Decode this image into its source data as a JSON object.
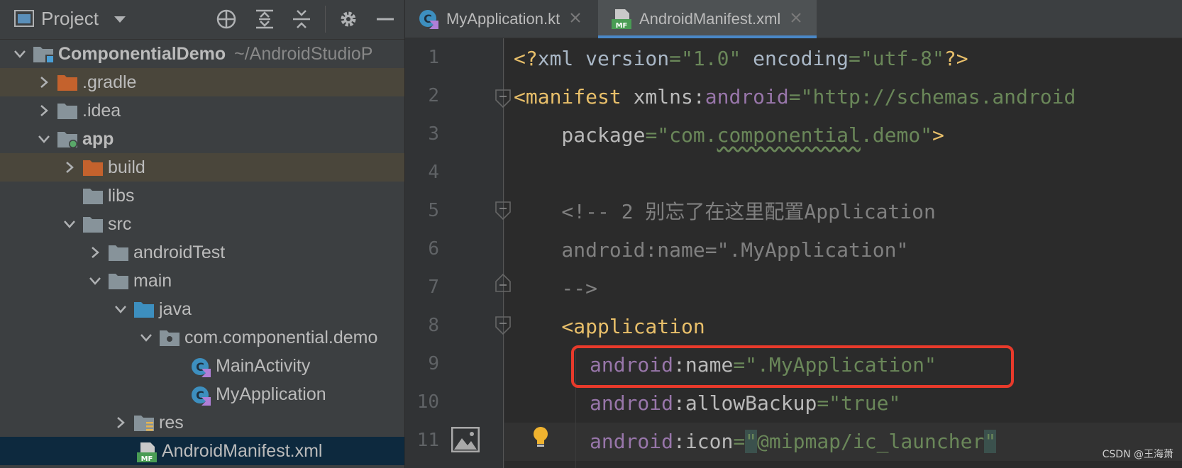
{
  "sidebar": {
    "title": "Project",
    "icons": [
      "project-window-icon",
      "chevron-down-icon",
      "locate-icon",
      "expand-all-icon",
      "collapse-all-icon",
      "gear-icon",
      "minimize-icon"
    ],
    "tree": [
      {
        "label": "ComponentialDemo",
        "path": "~/AndroidStudioP",
        "type": "module-folder",
        "expanded": true
      },
      {
        "label": ".gradle",
        "type": "folder-orange",
        "expanded": false
      },
      {
        "label": ".idea",
        "type": "folder",
        "expanded": false
      },
      {
        "label": "app",
        "type": "module-folder",
        "expanded": true
      },
      {
        "label": "build",
        "type": "folder-orange",
        "expanded": false
      },
      {
        "label": "libs",
        "type": "folder"
      },
      {
        "label": "src",
        "type": "folder",
        "expanded": true
      },
      {
        "label": "androidTest",
        "type": "folder",
        "expanded": false
      },
      {
        "label": "main",
        "type": "folder",
        "expanded": true
      },
      {
        "label": "java",
        "type": "folder-blue",
        "expanded": true
      },
      {
        "label": "com.componential.demo",
        "type": "package",
        "expanded": true
      },
      {
        "label": "MainActivity",
        "type": "kotlin-class"
      },
      {
        "label": "MyApplication",
        "type": "kotlin-class"
      },
      {
        "label": "res",
        "type": "res-folder",
        "expanded": false
      },
      {
        "label": "AndroidManifest.xml",
        "type": "manifest-file",
        "selected": true
      }
    ]
  },
  "tabs": [
    {
      "label": "MyApplication.kt",
      "icon": "kotlin-class-icon",
      "active": false
    },
    {
      "label": "AndroidManifest.xml",
      "icon": "manifest-icon",
      "active": true
    }
  ],
  "editor": {
    "line_numbers": [
      "1",
      "2",
      "3",
      "4",
      "5",
      "6",
      "7",
      "8",
      "9",
      "10",
      "11"
    ],
    "lines": {
      "l1": {
        "a": "<?",
        "b": "xml version",
        "c": "=",
        "d": "\"1.0\"",
        "e": " encoding",
        "f": "=",
        "g": "\"utf-8\"",
        "h": "?>"
      },
      "l2": {
        "a": "<manifest ",
        "b": "xmlns:",
        "c": "android",
        "d": "=",
        "e": "\"http://schemas.android"
      },
      "l3": {
        "a": "    package",
        "b": "=",
        "c": "\"com.",
        "d": "componential",
        "e": ".demo\"",
        "f": ">"
      },
      "l5": "    <!-- 2 别忘了在这里配置Application",
      "l6": "    android:name=\".MyApplication\"",
      "l7": "    -->",
      "l8": {
        "a": "    <application"
      },
      "l9": {
        "a": "android",
        "b": ":name",
        "c": "=",
        "d": "\".MyApplication\""
      },
      "l10": {
        "a": "android",
        "b": ":allowBackup",
        "c": "=",
        "d": "\"true\""
      },
      "l11": {
        "a": "android",
        "b": ":icon",
        "c": "=",
        "d": "\"",
        "e": "@mipmap/ic_launcher",
        "f": "\""
      }
    }
  },
  "watermark": "CSDN @王海萧",
  "colors": {
    "highlight_box": "#e83a2b",
    "tab_underline": "#4a88c7"
  }
}
